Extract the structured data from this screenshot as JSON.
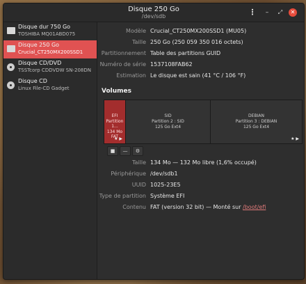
{
  "window": {
    "title": "Disque 250 Go",
    "subtitle": "/dev/sdb",
    "buttons": {
      "menu": "⋮",
      "minimize": "–",
      "maximize": "⤢",
      "close": "✕"
    }
  },
  "sidebar": {
    "items": [
      {
        "name": "Disque dur 750 Go",
        "sub": "TOSHIBA MQ01ABD075",
        "icon": "hard-disk-icon"
      },
      {
        "name": "Disque 250 Go",
        "sub": "Crucial_CT250MX200SSD1",
        "icon": "hard-disk-icon",
        "selected": true
      },
      {
        "name": "Disque CD/DVD",
        "sub": "TSSTcorp CDDVDW SN-208DN",
        "icon": "optical-disc-icon"
      },
      {
        "name": "Disque CD",
        "sub": "Linux File-CD Gadget",
        "icon": "optical-disc-icon"
      }
    ]
  },
  "disk": {
    "modele_label": "Modèle",
    "modele": "Crucial_CT250MX200SSD1 (MU05)",
    "taille_label": "Taille",
    "taille": "250 Go (250 059 350 016 octets)",
    "partitionnement_label": "Partitionnement",
    "partitionnement": "Table des partitions GUID",
    "serie_label": "Numéro de série",
    "serie": "1537108FAB62",
    "estimation_label": "Estimation",
    "estimation": "Le disque est sain (41 °C / 106 °F)"
  },
  "volumes": {
    "heading": "Volumes",
    "partitions": [
      {
        "name": "EFI",
        "num": "Partition 1...",
        "info": "134 Mo FAT",
        "marks": "★ ▶"
      },
      {
        "name": "SID",
        "num": "Partition 2 : SID",
        "info": "125 Go Ext4",
        "marks": ""
      },
      {
        "name": "DEBIAN",
        "num": "Partition 3 : DEBIAN",
        "info": "125 Go Ext4",
        "marks": "★ ▶"
      }
    ],
    "toolbar": {
      "stop": "■",
      "minus": "—",
      "settings": "⚙"
    }
  },
  "partition": {
    "taille_label": "Taille",
    "taille": "134 Mo — 132 Mo libre (1,6% occupé)",
    "peripherique_label": "Périphérique",
    "peripherique": "/dev/sdb1",
    "uuid_label": "UUID",
    "uuid": "1025-23E5",
    "type_label": "Type de partition",
    "type": "Système EFI",
    "contenu_label": "Contenu",
    "contenu_prefix": "FAT (version 32 bit) — Monté sur ",
    "contenu_link": "/boot/efi"
  },
  "colors": {
    "accent": "#e05252",
    "window_bg": "#2e2e2e"
  }
}
